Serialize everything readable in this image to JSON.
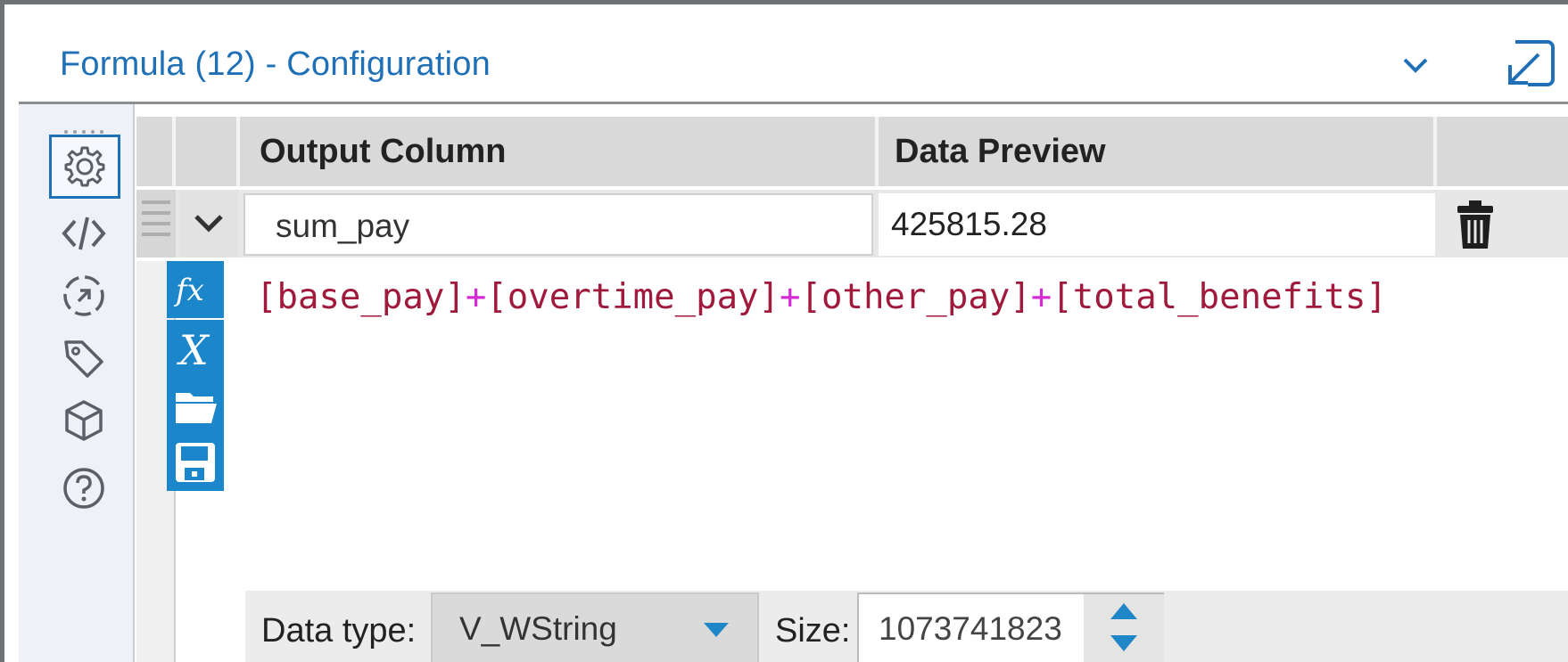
{
  "window": {
    "title": "Formula (12) - Configuration",
    "icons": {
      "collapse": "chevron-down-icon",
      "popout": "popout-icon"
    }
  },
  "sidebar": {
    "items": [
      {
        "name": "configuration",
        "icon": "gear-icon",
        "active": true
      },
      {
        "name": "annotation",
        "icon": "code-icon",
        "active": false
      },
      {
        "name": "workflow-dependencies",
        "icon": "target-icon",
        "active": false
      },
      {
        "name": "tags",
        "icon": "tag-icon",
        "active": false
      },
      {
        "name": "package",
        "icon": "cube-icon",
        "active": false
      },
      {
        "name": "help",
        "icon": "help-icon",
        "active": false
      }
    ]
  },
  "grid": {
    "columns": [
      "Output Column",
      "Data Preview"
    ],
    "row": {
      "output_column": "sum_pay",
      "data_preview": "425815.28"
    },
    "expression": {
      "tokens": [
        {
          "text": "[base_pay]",
          "kind": "field"
        },
        {
          "text": "+",
          "kind": "op"
        },
        {
          "text": "[overtime_pay]",
          "kind": "field"
        },
        {
          "text": "+",
          "kind": "op"
        },
        {
          "text": "[other_pay]",
          "kind": "field"
        },
        {
          "text": "+",
          "kind": "op"
        },
        {
          "text": "[total_benefits]",
          "kind": "field"
        }
      ]
    },
    "tools": [
      "functions-icon",
      "variables-icon",
      "open-expression-icon",
      "save-expression-icon"
    ],
    "data_type_label": "Data type:",
    "data_type_value": "V_WString",
    "size_label": "Size:",
    "size_value": "1073741823"
  },
  "colors": {
    "accent": "#1f70b7",
    "tool_button": "#1b86c9",
    "field_token": "#a01a3c",
    "operator_token": "#d42bd4"
  }
}
